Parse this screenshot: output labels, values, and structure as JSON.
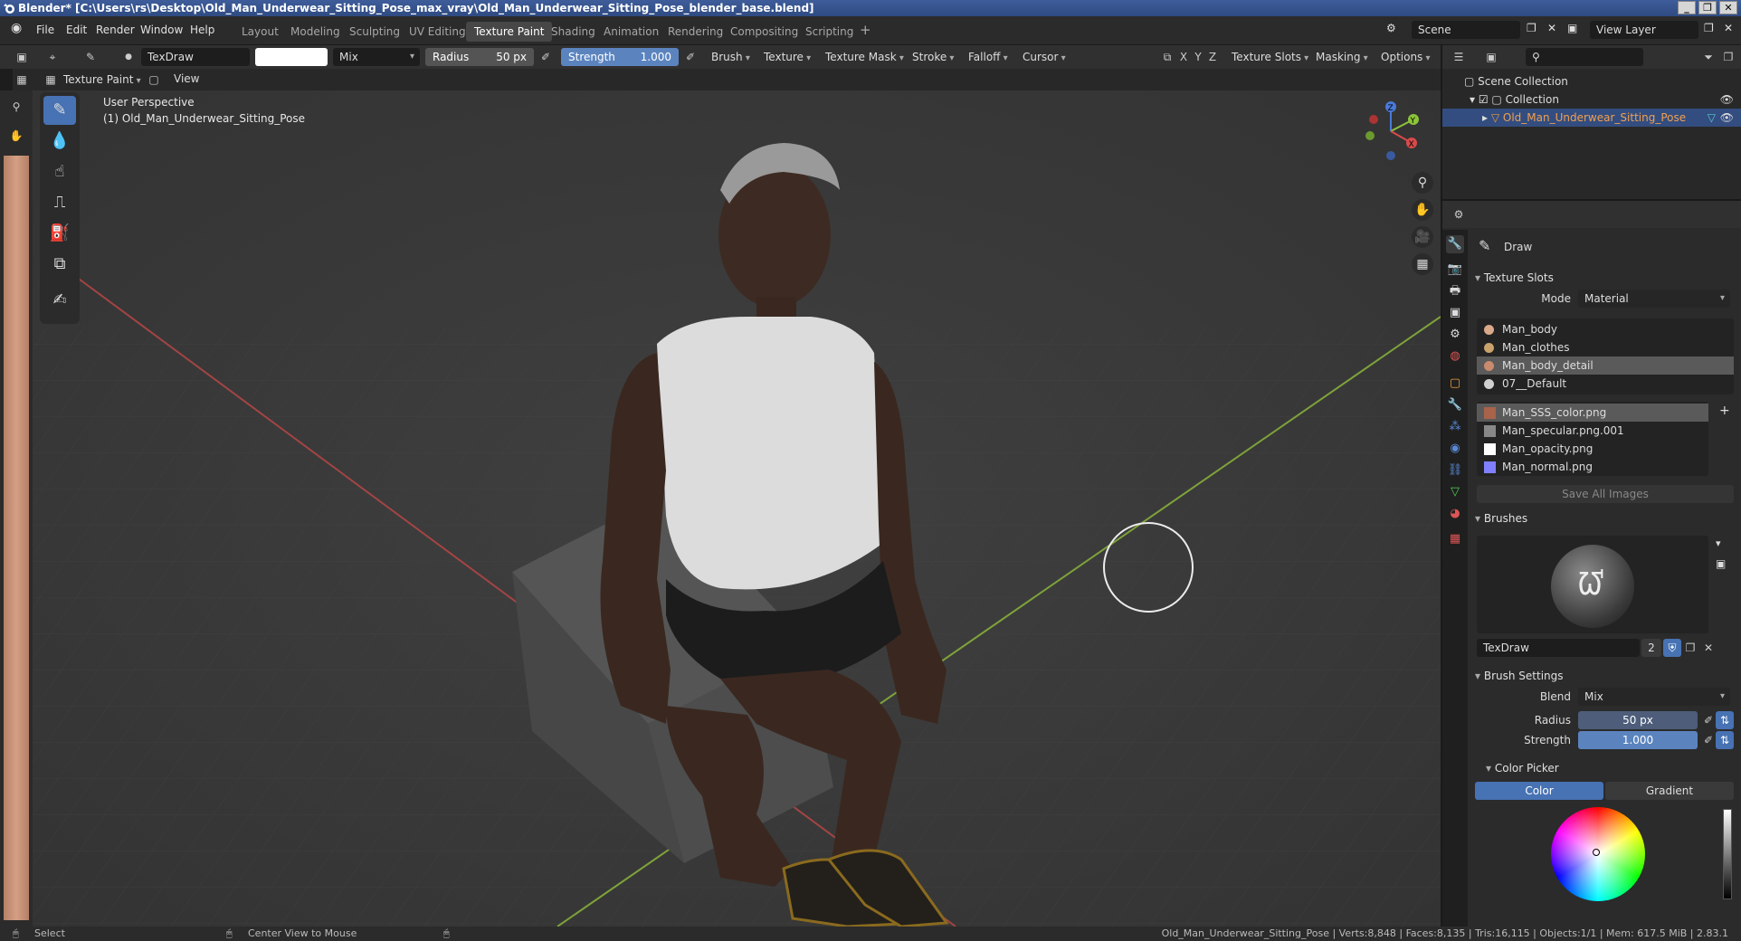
{
  "window": {
    "title": "Blender* [C:\\Users\\rs\\Desktop\\Old_Man_Underwear_Sitting_Pose_max_vray\\Old_Man_Underwear_Sitting_Pose_blender_base.blend]"
  },
  "menu": {
    "file": "File",
    "edit": "Edit",
    "render": "Render",
    "window": "Window",
    "help": "Help"
  },
  "workspaces": [
    "Layout",
    "Modeling",
    "Sculpting",
    "UV Editing",
    "Texture Paint",
    "Shading",
    "Animation",
    "Rendering",
    "Compositing",
    "Scripting"
  ],
  "active_workspace": "Texture Paint",
  "scene": {
    "name": "Scene",
    "view_layer": "View Layer"
  },
  "tool_header": {
    "brush_name": "TexDraw",
    "blend": "Mix",
    "radius_label": "Radius",
    "radius_value": "50 px",
    "strength_label": "Strength",
    "strength_value": "1.000",
    "brush": "Brush",
    "texture": "Texture",
    "texture_mask": "Texture Mask",
    "stroke": "Stroke",
    "falloff": "Falloff",
    "cursor": "Cursor",
    "x": "X",
    "y": "Y",
    "z": "Z",
    "texture_slots": "Texture Slots",
    "masking": "Masking",
    "options": "Options"
  },
  "header2": {
    "mode": "Texture Paint",
    "view": "View"
  },
  "viewport": {
    "line1": "User Perspective",
    "line2": "(1) Old_Man_Underwear_Sitting_Pose"
  },
  "gizmo": {
    "x": "X",
    "y": "Y",
    "z": "Z"
  },
  "outliner": {
    "scene_collection": "Scene Collection",
    "collection": "Collection",
    "object": "Old_Man_Underwear_Sitting_Pose"
  },
  "properties": {
    "tool_name": "Draw",
    "texture_slots": {
      "title": "Texture Slots",
      "mode_label": "Mode",
      "mode_value": "Material",
      "materials": [
        {
          "name": "Man_body",
          "color": "#d9a98a"
        },
        {
          "name": "Man_clothes",
          "color": "#c9a36b"
        },
        {
          "name": "Man_body_detail",
          "color": "#c98a6e"
        },
        {
          "name": "07__Default",
          "color": "#d0d0d0"
        }
      ],
      "selected_material": "Man_body_detail",
      "images": [
        {
          "name": "Man_SSS_color.png",
          "color": "#a8634a"
        },
        {
          "name": "Man_specular.png.001",
          "color": "#888888"
        },
        {
          "name": "Man_opacity.png",
          "color": "#ffffff"
        },
        {
          "name": "Man_normal.png",
          "color": "#8080ff"
        }
      ],
      "selected_image": "Man_SSS_color.png",
      "save_all": "Save All Images"
    },
    "brushes": {
      "title": "Brushes",
      "name": "TexDraw",
      "users": "2"
    },
    "brush_settings": {
      "title": "Brush Settings",
      "blend_label": "Blend",
      "blend_value": "Mix",
      "radius_label": "Radius",
      "radius_value": "50 px",
      "strength_label": "Strength",
      "strength_value": "1.000"
    },
    "color_picker": {
      "title": "Color Picker",
      "color_tab": "Color",
      "gradient_tab": "Gradient"
    }
  },
  "status": {
    "select": "Select",
    "center_view": "Center View to Mouse",
    "stats": "Old_Man_Underwear_Sitting_Pose | Verts:8,848 | Faces:8,135 | Tris:16,115 | Objects:1/1 | Mem: 617.5 MiB | 2.83.1"
  },
  "colors": {
    "accent": "#4772b3",
    "selected_row": "#334d80",
    "slider": "#5b84bf",
    "background": "#393939",
    "x_axis": "#d94a4a",
    "y_axis": "#8cc43a"
  }
}
